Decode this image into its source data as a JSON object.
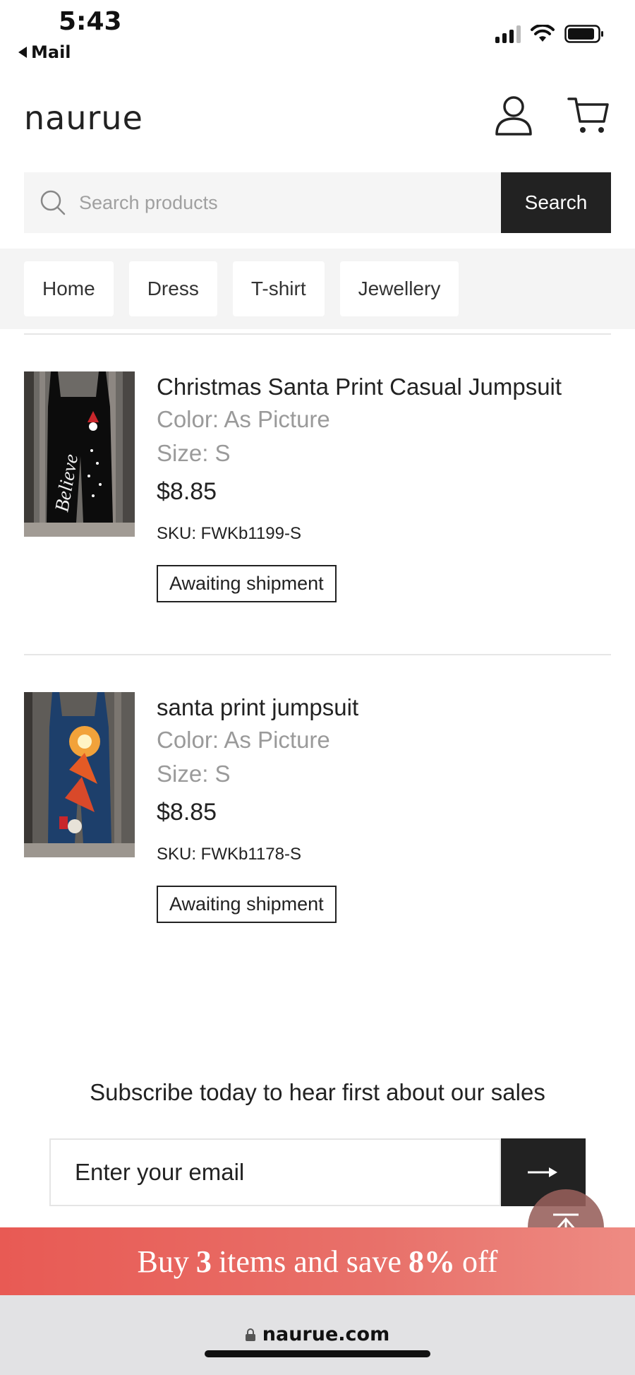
{
  "status_bar": {
    "time": "5:43",
    "back_label": "Mail"
  },
  "header": {
    "logo": "naurue",
    "account_icon": "user-icon",
    "cart_icon": "cart-icon"
  },
  "search": {
    "placeholder": "Search products",
    "button_label": "Search"
  },
  "nav": {
    "items": [
      {
        "label": "Home"
      },
      {
        "label": "Dress"
      },
      {
        "label": "T-shirt"
      },
      {
        "label": "Jewellery"
      }
    ]
  },
  "products": [
    {
      "title": "Christmas Santa Print Casual Jumpsuit",
      "color": "Color: As Picture",
      "size": "Size: S",
      "price": "$8.85",
      "sku": "SKU: FWKb1199-S",
      "status": "Awaiting shipment",
      "image_text": "Believe"
    },
    {
      "title": "santa print jumpsuit",
      "color": "Color: As Picture",
      "size": "Size: S",
      "price": "$8.85",
      "sku": "SKU: FWKb1178-S",
      "status": "Awaiting shipment"
    }
  ],
  "subscribe": {
    "heading": "Subscribe today to hear first about our sales",
    "email_placeholder": "Enter your email"
  },
  "promo": {
    "prefix": "Buy",
    "count": "3",
    "middle": "items and save",
    "discount": "8%",
    "suffix": "off"
  },
  "browser": {
    "url": "naurue.com"
  },
  "colors": {
    "accent_dark": "#222222",
    "promo_red": "#e85a54"
  }
}
